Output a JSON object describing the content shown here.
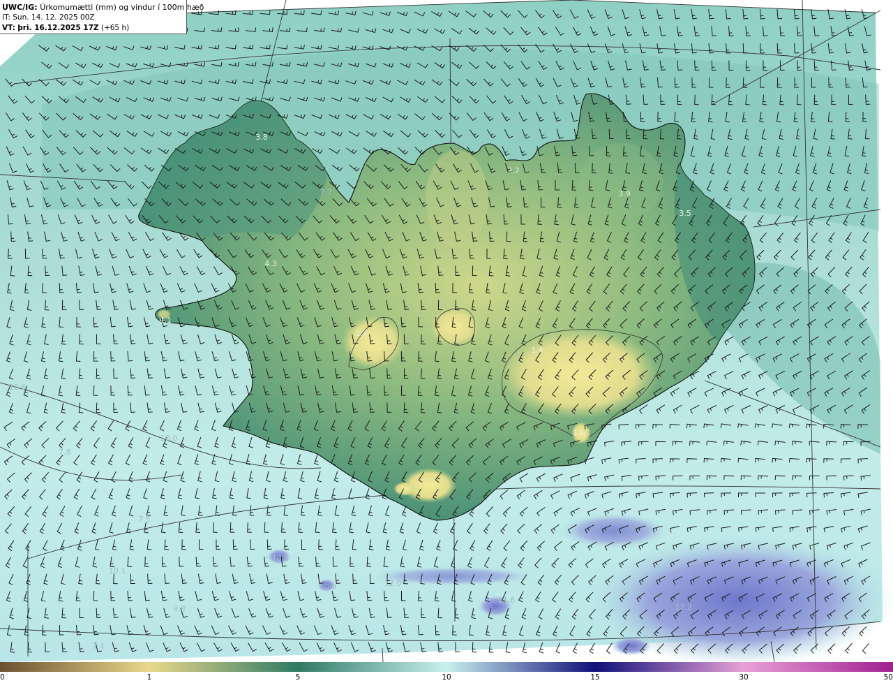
{
  "title": {
    "prefix": "UWC/IG:",
    "product": "Úrkomumætti (mm) og vindur í 100m hæð",
    "init_label": "IT:",
    "init_time": "Sun. 14. 12. 2025 00Z",
    "valid_label": "VT:",
    "valid_time": "þri. 16.12.2025 17Z",
    "lead": "(+65 h)"
  },
  "colors": {
    "ocean_light": "#bfeaea",
    "ocean_mid": "#8fd4c8",
    "land_dark": "#3f8a76",
    "land_mid": "#6aa780",
    "land_light": "#cfd88a",
    "ice_yellow": "#efe89a",
    "high_blue": "#8f9bd6",
    "deep_blue": "#5b62c0",
    "barb": "#1a1a1a",
    "coast": "#111111"
  },
  "value_labels": [
    {
      "text": "3.8",
      "kind": "land"
    },
    {
      "text": "7.7",
      "kind": "ocean"
    },
    {
      "text": "3.7",
      "kind": "land"
    },
    {
      "text": "3.9",
      "kind": "land"
    },
    {
      "text": "3.5",
      "kind": "land"
    },
    {
      "text": "5.9",
      "kind": "ocean"
    },
    {
      "text": "6.8",
      "kind": "ocean"
    },
    {
      "text": "4.3",
      "kind": "land"
    },
    {
      "text": "4.1",
      "kind": "land"
    },
    {
      "text": "2.4",
      "kind": "land"
    },
    {
      "text": "10.6",
      "kind": "ocean"
    },
    {
      "text": "10.0",
      "kind": "ocean"
    },
    {
      "text": "7.8",
      "kind": "ocean"
    },
    {
      "text": "7.5",
      "kind": "ocean"
    },
    {
      "text": "10.5",
      "kind": "ocean"
    },
    {
      "text": "12.0",
      "kind": "ocean"
    },
    {
      "text": "10.1",
      "kind": "ocean"
    },
    {
      "text": "9.8",
      "kind": "ocean"
    },
    {
      "text": "7.4",
      "kind": "ocean"
    },
    {
      "text": "11.6",
      "kind": "ocean"
    },
    {
      "text": "12.2",
      "kind": "ocean"
    },
    {
      "text": "9.1",
      "kind": "ocean"
    },
    {
      "text": "10.9",
      "kind": "ocean"
    },
    {
      "text": "1.4",
      "kind": "land"
    },
    {
      "text": "1.6",
      "kind": "land"
    },
    {
      "text": "8.6",
      "kind": "ocean"
    }
  ],
  "colorbar": {
    "ticks": [
      "0",
      "1",
      "5",
      "10",
      "15",
      "30",
      "50"
    ],
    "stops": [
      {
        "value": "0",
        "color": "#6b5030"
      },
      {
        "value": "1",
        "color": "#e8d88a"
      },
      {
        "value": "5",
        "color": "#2f7a64"
      },
      {
        "value": "10",
        "color": "#c8f0ee"
      },
      {
        "value": "15",
        "color": "#10107a"
      },
      {
        "value": "30",
        "color": "#e8a0d8"
      },
      {
        "value": "50",
        "color": "#a02090"
      }
    ]
  }
}
